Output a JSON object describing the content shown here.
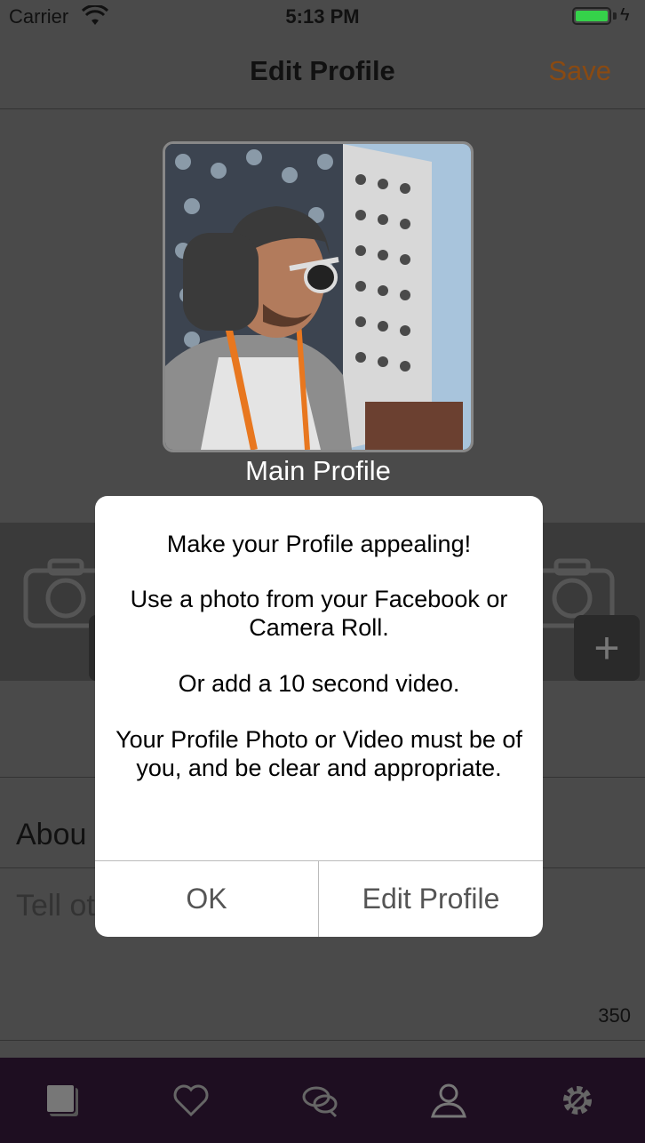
{
  "status": {
    "carrier": "Carrier",
    "time": "5:13 PM"
  },
  "nav": {
    "title": "Edit Profile",
    "save_label": "Save"
  },
  "profile": {
    "photo_label": "Main Profile"
  },
  "sections": {
    "about_label": "Abou",
    "tell_placeholder": "Tell ot",
    "char_count": "350"
  },
  "alert": {
    "line1": "Make your Profile appealing!",
    "line2": "Use a photo from your Facebook or Camera Roll.",
    "line3": "Or add a 10 second video.",
    "line4": "Your Profile Photo or Video must be of you, and be clear and appropriate.",
    "ok_label": "OK",
    "edit_label": "Edit Profile"
  },
  "colors": {
    "save": "#8a4a12",
    "tabbar": "#1e0e21",
    "battery": "#35d24a"
  },
  "tabs": [
    {
      "icon": "stack-icon"
    },
    {
      "icon": "heart-icon"
    },
    {
      "icon": "chat-icon"
    },
    {
      "icon": "person-icon"
    },
    {
      "icon": "gear-icon"
    }
  ]
}
